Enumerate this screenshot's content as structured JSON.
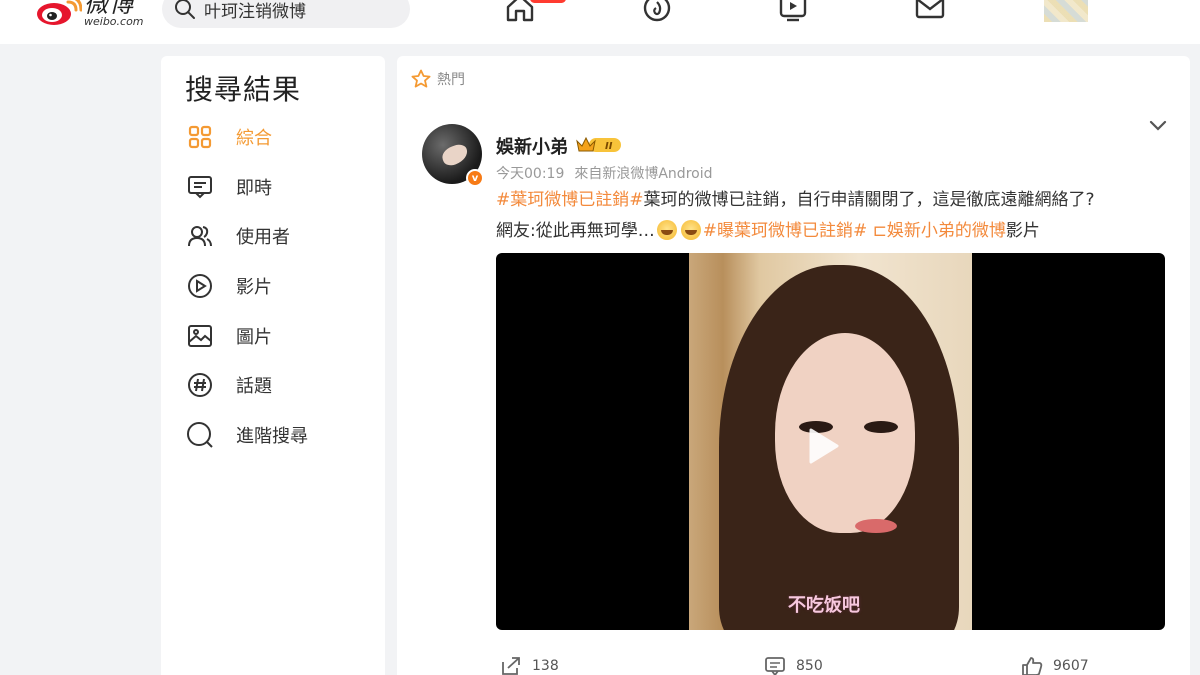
{
  "header": {
    "logo_cn": "微博",
    "logo_en": "weibo.com",
    "search_text": "叶珂注销微博",
    "nav_icons": [
      "home-icon",
      "hot-flame-icon",
      "video-icon",
      "mail-icon"
    ]
  },
  "sidebar": {
    "title": "搜尋結果",
    "items": [
      {
        "label": "綜合",
        "icon": "grid-icon",
        "active": true
      },
      {
        "label": "即時",
        "icon": "chat-list-icon"
      },
      {
        "label": "使用者",
        "icon": "users-icon"
      },
      {
        "label": "影片",
        "icon": "play-circle-icon"
      },
      {
        "label": "圖片",
        "icon": "image-icon"
      },
      {
        "label": "話題",
        "icon": "hashtag-icon"
      },
      {
        "label": "進階搜尋",
        "icon": "search-icon"
      }
    ]
  },
  "feed": {
    "section_label": "熱門",
    "post": {
      "username": "娛新小弟",
      "time": "今天00:19",
      "source": "來自新浪微博Android",
      "tag1": "#葉珂微博已註銷#",
      "text1": "葉珂的微博已註銷，自行申請關閉了，這是徹底遠離網絡了?",
      "text2": "網友:從此再無珂學…",
      "tag2": "#曝葉珂微博已註銷#",
      "video_link": " ⊏娛新小弟的微博",
      "video_suffix": "影片",
      "video_caption": "不吃饭吧",
      "reposts": "138",
      "comments": "850",
      "likes": "9607"
    }
  },
  "colors": {
    "accent": "#f49a33",
    "tag": "#f38a3c",
    "badge": "#ff3b30"
  }
}
